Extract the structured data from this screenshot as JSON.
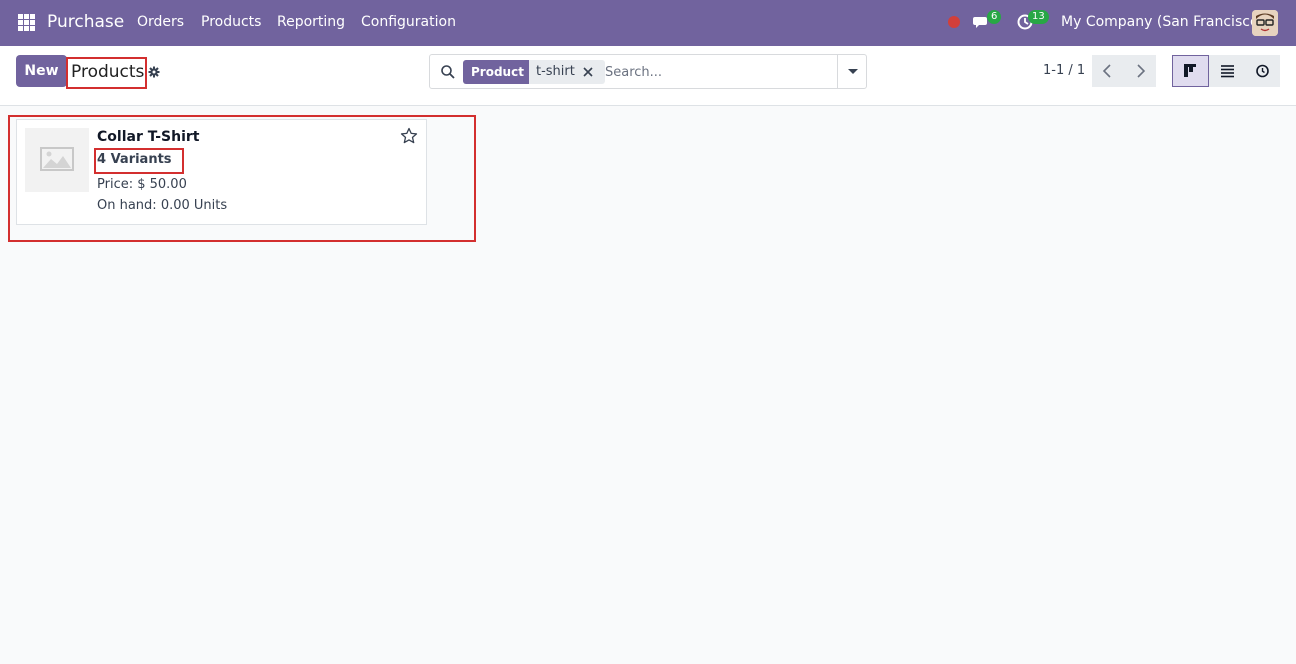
{
  "navbar": {
    "app_name": "Purchase",
    "menu": [
      "Orders",
      "Products",
      "Reporting",
      "Configuration"
    ],
    "messages_count": "6",
    "activities_count": "13",
    "company": "My Company (San Francisco)",
    "colors": {
      "brand": "#71639e",
      "badge": "#28a745",
      "recording": "#d23f3a"
    }
  },
  "control_panel": {
    "new_label": "New",
    "title": "Products",
    "search": {
      "facet_label": "Product",
      "facet_value": "t-shirt",
      "placeholder": "Search..."
    },
    "pager": "1-1 / 1"
  },
  "kanban": {
    "cards": [
      {
        "name": "Collar T-Shirt",
        "variants": "4 Variants",
        "price": "Price: $ 50.00",
        "on_hand": "On hand: 0.00 Units"
      }
    ]
  },
  "icons": [
    "apps-grid-icon",
    "chat-icon",
    "clock-icon",
    "search-icon",
    "close-icon",
    "caret-down-icon",
    "chevron-left-icon",
    "chevron-right-icon",
    "kanban-view-icon",
    "list-view-icon",
    "activity-view-icon",
    "star-icon",
    "image-placeholder-icon",
    "gear-icon"
  ]
}
